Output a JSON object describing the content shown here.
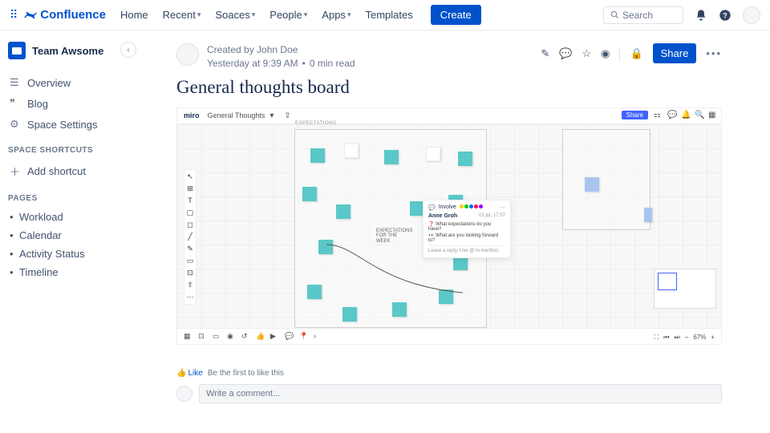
{
  "app": {
    "name": "Confluence"
  },
  "nav": {
    "home": "Home",
    "recent": "Recent",
    "spaces": "Soaces",
    "people": "People",
    "apps": "Apps",
    "templates": "Templates",
    "create": "Create"
  },
  "search": {
    "placeholder": "Search"
  },
  "sidebar": {
    "space": "Team Awsome",
    "overview": "Overview",
    "blog": "Blog",
    "settings": "Space Settings",
    "shortcuts_hdr": "SPACE SHORTCUTS",
    "add_shortcut": "Add shortcut",
    "pages_hdr": "PAGES",
    "pages": [
      "Workload",
      "Calendar",
      "Activity Status",
      "Timeline"
    ]
  },
  "page": {
    "created_by": "Created by John Doe",
    "meta": "Yesterday at 9:39 AM",
    "read": "0 min read",
    "title": "General thoughts board",
    "share": "Share"
  },
  "miro": {
    "logo": "miro",
    "board": "General Thoughts",
    "share": "Share",
    "frame_label": "EXPECTATIONS",
    "note_label": "EXPECTATIONS FOR THE WEEK",
    "zoom": "67%",
    "comment": {
      "tag": "Involve",
      "name": "Anne Groh",
      "time": "01 jul, 17:57",
      "q1": "What expectations do you have?",
      "q2": "What are you looking forward to?",
      "reply": "Leave a reply. Use @ to mention."
    }
  },
  "footer": {
    "like": "Like",
    "first": "Be the first to like this",
    "comment_ph": "Write a comment..."
  }
}
